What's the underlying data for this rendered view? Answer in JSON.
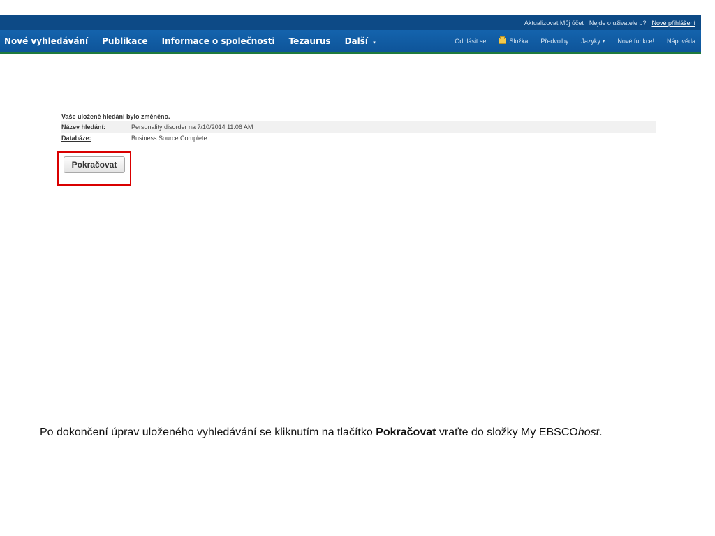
{
  "topbar": {
    "update_account": "Aktualizovat Můj účet",
    "not_user": "Nejde o uživatele p?",
    "new_login": "Nové přihlášení"
  },
  "nav": {
    "main": [
      "Nové vyhledávání",
      "Publikace",
      "Informace o společnosti",
      "Tezaurus",
      "Další"
    ],
    "more_caret": "▾",
    "right": {
      "logout": "Odhlásit se",
      "folder": "Složka",
      "preferences": "Předvolby",
      "languages": "Jazyky",
      "new_features": "Nové funkce!",
      "help": "Nápověda"
    }
  },
  "content": {
    "message": "Vaše uložené hledání bylo změněno.",
    "name_label": "Název hledání:",
    "name_value": "Personality disorder na 7/10/2014 11:06 AM",
    "db_label": "Databáze:",
    "db_value": "Business Source Complete",
    "continue_button": "Pokračovat"
  },
  "caption": {
    "part1": "Po dokončení úprav uloženého vyhledávání se kliknutím na tlačítko ",
    "bold": "Pokračovat",
    "part2": " vraťte do složky My EBSCO",
    "italic": "host",
    "part3": "."
  },
  "colors": {
    "nav_blue": "#0e559a",
    "topbar_blue": "#0d4a86",
    "highlight_red": "#d90000"
  },
  "icons": [
    "folder-icon",
    "chevron-down-icon"
  ]
}
